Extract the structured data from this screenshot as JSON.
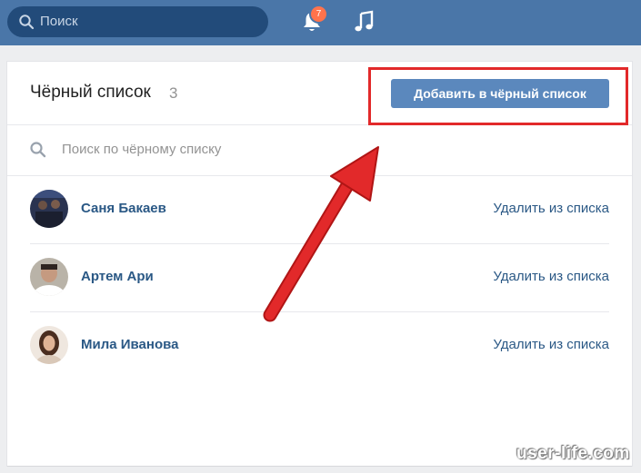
{
  "topbar": {
    "search_placeholder": "Поиск",
    "notifications_count": "7"
  },
  "blacklist": {
    "title": "Чёрный список",
    "count": "3",
    "add_button": "Добавить в чёрный список",
    "filter_placeholder": "Поиск по чёрному списку",
    "users": [
      {
        "name": "Саня Бакаев",
        "action": "Удалить из списка"
      },
      {
        "name": "Артем Ари",
        "action": "Удалить из списка"
      },
      {
        "name": "Мила Иванова",
        "action": "Удалить из списка"
      }
    ]
  },
  "annotation": {
    "color": "#e2292a"
  },
  "watermark": "user-life.com"
}
